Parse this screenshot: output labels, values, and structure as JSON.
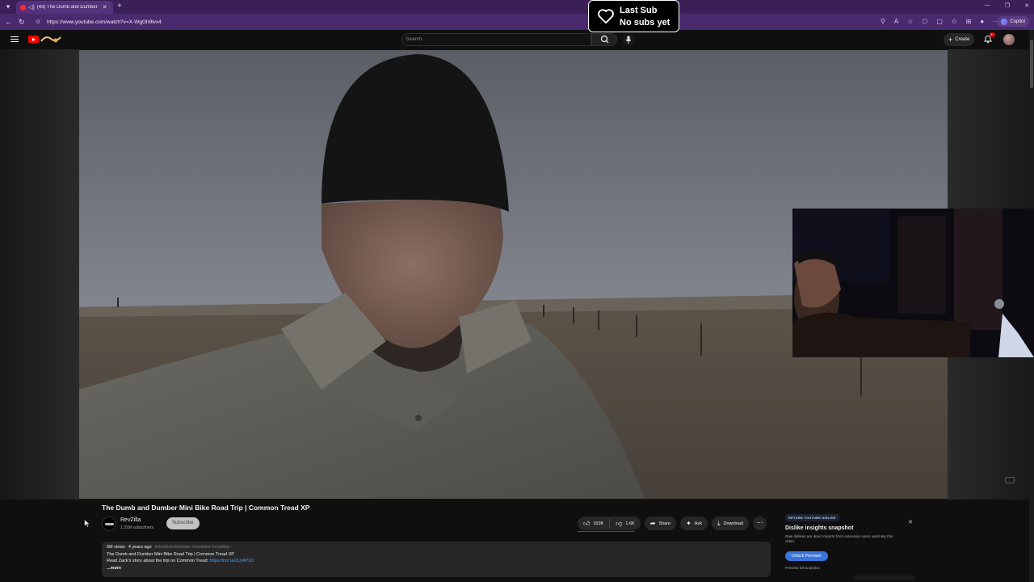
{
  "browser": {
    "tab_title": "(43) The Dumb and Dumber",
    "url": "https://www.youtube.com/watch?v=X-WgGh9lvx4",
    "copilot_label": "Copilot"
  },
  "masthead": {
    "search_placeholder": "Search",
    "create_label": "Create",
    "notifications_count": "9+"
  },
  "alert": {
    "line1": "Last Sub",
    "line2": "No subs yet"
  },
  "video": {
    "title": "The Dumb and Dumber Mini Bike Road Trip | Common Tread XP"
  },
  "channel": {
    "name": "RevZilla",
    "subscribers": "1.31M subscribers",
    "subscribe_label": "Subscribe"
  },
  "actions": {
    "likes": "153K",
    "dislikes": "1.6K",
    "share_label": "Share",
    "ask_label": "Ask",
    "download_label": "Download"
  },
  "description": {
    "views": "5M views",
    "age": "4 years ago",
    "tags": "#dumbanddumber #minibike #roadtrip",
    "line1": "The Dumb and Dumber Mini Bike Road Trip | Common Tread XP",
    "line2_prefix": "Read Zack's story about the trip on Common Tread: ",
    "line2_link": "https://rvz.la/2UzAYxD",
    "more_label": "...more"
  },
  "dislike_panel": {
    "badge": "RETURN YOUTUBE DISLIKE",
    "title": "Dislike insights snapshot",
    "subtitle": "Raw dislikes are direct reports from extension users watching this video.",
    "unlock_label": "Unlock Premium",
    "preview_label": "Preview full analytics"
  },
  "colors": {
    "browser_frame": "#4a2a6e",
    "page_bg": "#0f0f0f",
    "link": "#3ea6ff",
    "unlock": "#3b74d8"
  }
}
